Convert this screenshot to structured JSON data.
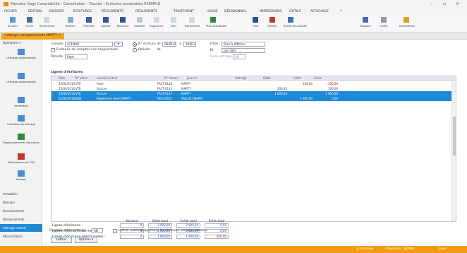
{
  "titlebar": {
    "title": "Mercator Sage Comptabilité - Consultation - Dossier : Ecritures comptables EXEMPLE",
    "minimize": "–",
    "maximize": "▫",
    "close": "×"
  },
  "menu": [
    "FICHIER",
    "EDITION",
    "DOSSIER",
    "ÉCRITURES",
    "RÈGLEMENTS",
    "RÈGLEMENTS",
    "TRAITEMENT",
    "SAISIE",
    "DÉCISIONNEL",
    "IMPRESSIONS",
    "OUTILS",
    "AFFICHAGE",
    "?"
  ],
  "ribbon": [
    "Annuler",
    "Ouvrir",
    "Rechercher",
    "Relever",
    "Planifier",
    "Ajouter",
    "Nouveau",
    "Modifier",
    "Supprimer",
    "Trier",
    "Rechercher",
    "Plan comptable",
    "Tiers",
    "Pointer",
    "Saisie de compte",
    "Rapport",
    "Outils",
    "Paramètres"
  ],
  "tab": {
    "label": "Lettrage comptes/clients MARTY ×"
  },
  "sidebar": {
    "header": "Opérations ▾",
    "nav": [
      {
        "label": "Lettrage automatique",
        "icon": "lettrage-icon"
      },
      {
        "label": "Lettrage automatique",
        "icon": "lettrage-icon"
      },
      {
        "label": "Ventilation",
        "icon": "ventilation-icon"
      },
      {
        "label": "Contrôles du lettrage",
        "icon": "control-icon"
      },
      {
        "label": "Rapprochements bancaires",
        "icon": "bank-icon"
      },
      {
        "label": "Déclarations de TVA",
        "icon": "tva-icon"
      },
      {
        "label": "Budget",
        "icon": "budget-icon"
      }
    ],
    "links": [
      "Immobilier",
      "Dossiers",
      "Encaissements",
      "Décaissements",
      "Lettrage manuel",
      "Réconciliation"
    ],
    "active_link": "Lettrage manuel"
  },
  "filters": {
    "compte_label": "Compte",
    "compte_value": "411MAR",
    "compte_btn": "▾",
    "chk_sans_lettrage": "Ecritures de comptes non rapprochées",
    "periode_label": "Période",
    "periode_value": "Sept",
    "radio_nb_label": "N° écriture",
    "radio_de_label": "de",
    "radio_de_value": "06/01/2",
    "radio_a_label": "à",
    "radio_a_value": "30/01/",
    "radio_periode_label": "Période",
    "radio_periode_de": "de",
    "filtre_label": "Filtre",
    "filtre_value": "Rien à afficher",
    "etat_label": "Et",
    "etat_value": "par date",
    "lettrage_label": "Code lettrage",
    "lettrage_value": "AB"
  },
  "grid": {
    "section_title": "Lignes d'écritures",
    "columns": [
      "Date",
      "N° pièce",
      "Libellé écriture",
      "N° facture",
      "Journal",
      "Lettrage",
      "Débit",
      "Crédit",
      "Solde"
    ],
    "rows": [
      {
        "date": "23/04/2014",
        "piece": "VTE",
        "libelle": "Avoir",
        "facture": "FACT-0128",
        "journal": "MARTY",
        "lettrage": "",
        "debit": "",
        "credit": "100,00",
        "solde": "-100,00",
        "selected": false
      },
      {
        "date": "25/04/2014",
        "piece": "VTE",
        "libelle": "Facture",
        "facture": "FACT-0131",
        "journal": "MARTY",
        "lettrage": "",
        "debit": "200,00",
        "credit": "",
        "solde": "100,00",
        "selected": false
      },
      {
        "date": "12/05/2014",
        "piece": "VTE",
        "libelle": "Facture",
        "facture": "FACT-0147",
        "journal": "MARTY",
        "lettrage": "",
        "debit": "1 800,00",
        "credit": "",
        "solde": "1 900,00",
        "selected": true
      },
      {
        "date": "21/05/2014",
        "piece": "BNK",
        "libelle": "Règlement client MARTY",
        "facture": "REG-0052",
        "journal": "Règl 411MARTY",
        "lettrage": "",
        "debit": "",
        "credit": "1 900,00",
        "solde": "0,00",
        "selected": true
      }
    ]
  },
  "totals": {
    "headers": [
      "Nombre",
      "Débit total",
      "Crédit total",
      "Solde total"
    ],
    "rows": [
      {
        "label": "Lignes d'écritures :",
        "values": [
          "4",
          "2 000,00",
          "2 000,00",
          "0,00"
        ]
      },
      {
        "label": "Lignes d'écritures non lettrées :",
        "values": [
          "4",
          "2 000,00",
          "2 000,00",
          "0,00"
        ]
      },
      {
        "label": "Lignes d'écritures sélectionnées :",
        "values": [
          "2",
          "1 800,00",
          "1 900,00",
          "-100,00"
        ]
      }
    ]
  },
  "bottom": {
    "prochain_label": "Prochain code lettrage :",
    "prochain_value": "AB",
    "chk_auto": "Lettrer automatiquement les écritures correspondantes",
    "btn_lettrer": "Lettrer",
    "btn_options": "Options ▾"
  },
  "status": [
    "4 écritures",
    "Utilisateur : ADMIN",
    "Sage"
  ],
  "colors": {
    "accent": "#1e8ad6",
    "brand": "#f39b12",
    "negative": "#c00000"
  }
}
